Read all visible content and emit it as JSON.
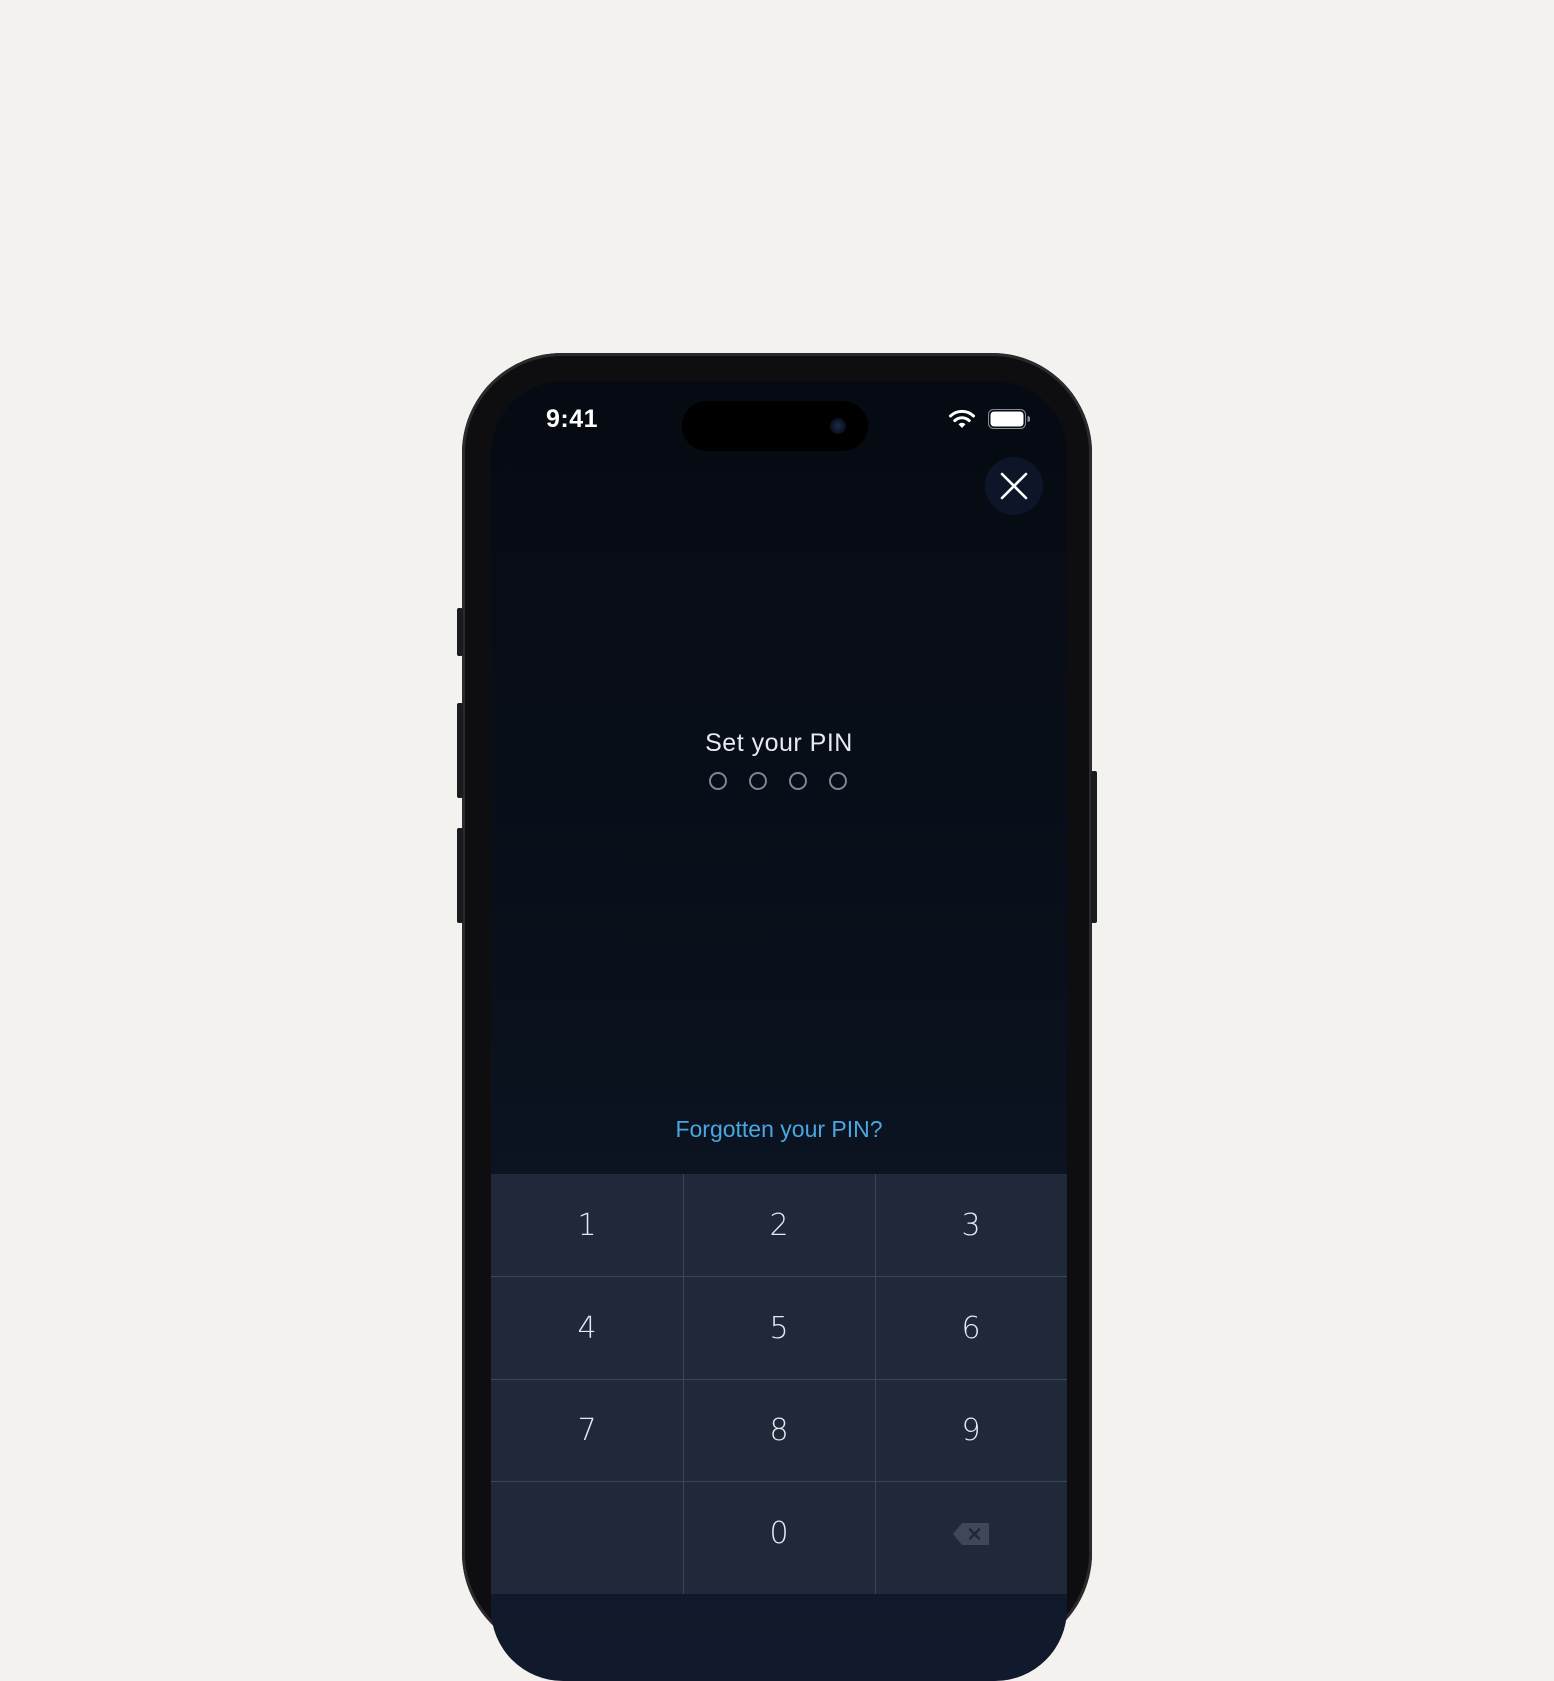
{
  "status_bar": {
    "time": "9:41",
    "wifi_icon": "wifi-icon",
    "battery_icon": "battery-icon"
  },
  "header": {
    "close_icon": "close-icon"
  },
  "pin": {
    "title": "Set your PIN",
    "length": 4,
    "entered": 0
  },
  "forgot_link": "Forgotten your PIN?",
  "keypad": {
    "keys": [
      "1",
      "2",
      "3",
      "4",
      "5",
      "6",
      "7",
      "8",
      "9",
      "",
      "0"
    ],
    "backspace_icon": "backspace-icon"
  },
  "colors": {
    "accent": "#4aa6e0",
    "keypad_bg": "#1f293a",
    "screen_bg": "#0a101b"
  }
}
